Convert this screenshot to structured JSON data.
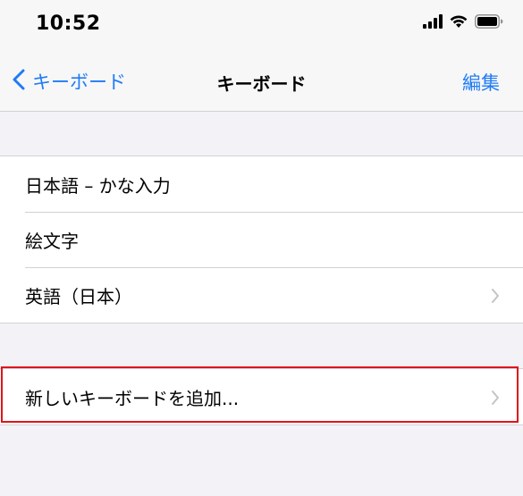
{
  "status_bar": {
    "time": "10:52"
  },
  "nav": {
    "back_label": "キーボード",
    "title": "キーボード",
    "edit_label": "編集"
  },
  "keyboards": [
    {
      "label": "日本語 – かな入力",
      "has_chevron": false
    },
    {
      "label": "絵文字",
      "has_chevron": false
    },
    {
      "label": "英語（日本）",
      "has_chevron": true
    }
  ],
  "add_keyboard": {
    "label": "新しいキーボードを追加..."
  },
  "colors": {
    "accent": "#1f7bf6",
    "background": "#f2f2f7",
    "highlight": "#e0141a"
  },
  "icons": [
    "signal-icon",
    "wifi-icon",
    "battery-icon",
    "back-chevron-icon",
    "chevron-right-icon"
  ]
}
